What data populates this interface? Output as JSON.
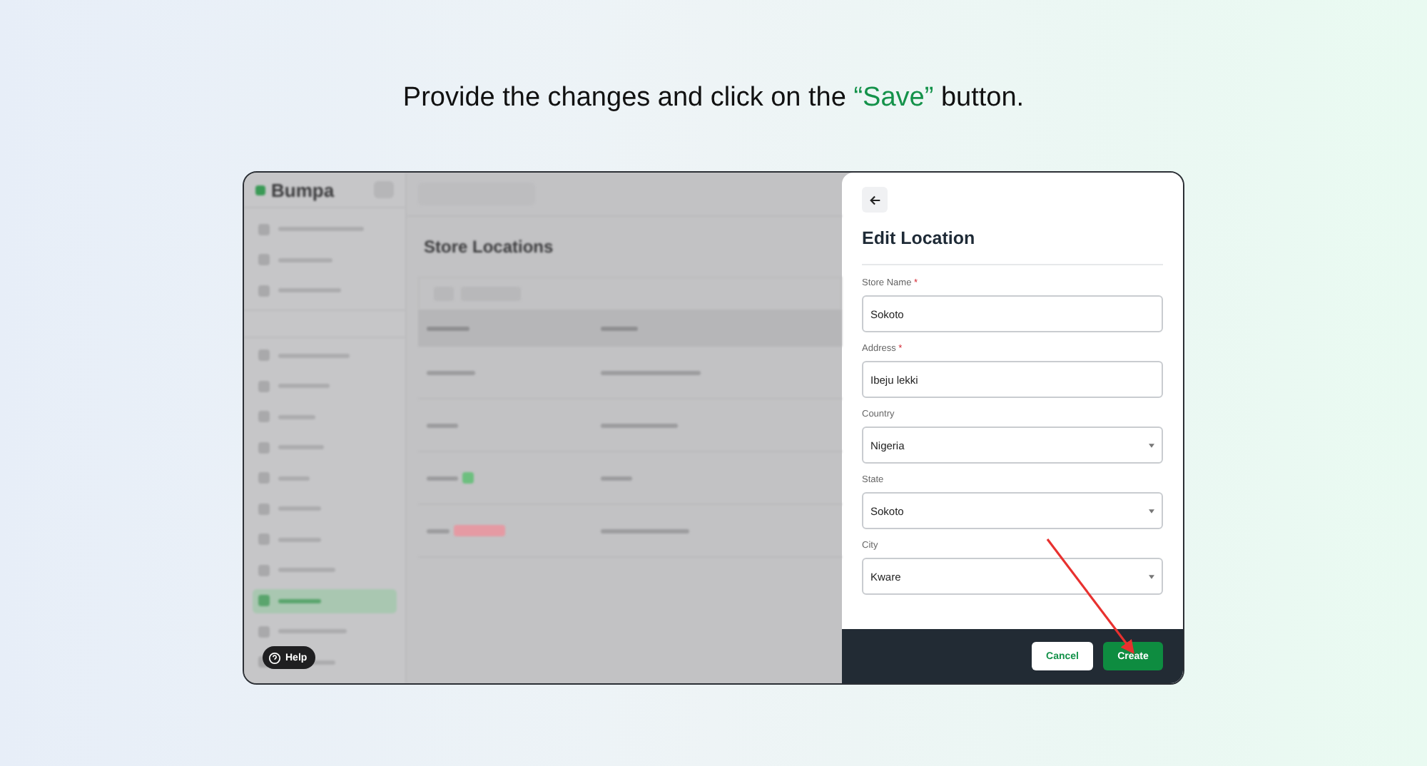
{
  "instruction": {
    "parts": [
      {
        "text": "Provide the changes and click on the ",
        "highlight": false
      },
      {
        "text": "“Save”",
        "highlight": true
      },
      {
        "text": " button.",
        "highlight": false
      }
    ]
  },
  "background_app": {
    "logo": "Bumpa",
    "page_title": "Store Locations",
    "help_button": "Help"
  },
  "edit_panel": {
    "title": "Edit Location",
    "fields": [
      {
        "kind": "text",
        "label": "Store Name",
        "required_mark": "*",
        "value": "Sokoto"
      },
      {
        "kind": "text",
        "label": "Address",
        "required_mark": "*",
        "value": "Ibeju lekki"
      },
      {
        "kind": "select",
        "label": "Country",
        "value": "Nigeria"
      },
      {
        "kind": "select",
        "label": "State",
        "value": "Sokoto"
      },
      {
        "kind": "select",
        "label": "City",
        "value": "Kware"
      }
    ],
    "buttons": [
      {
        "kind": "secondary",
        "label": "Cancel"
      },
      {
        "kind": "primary",
        "label": "Create"
      }
    ]
  }
}
